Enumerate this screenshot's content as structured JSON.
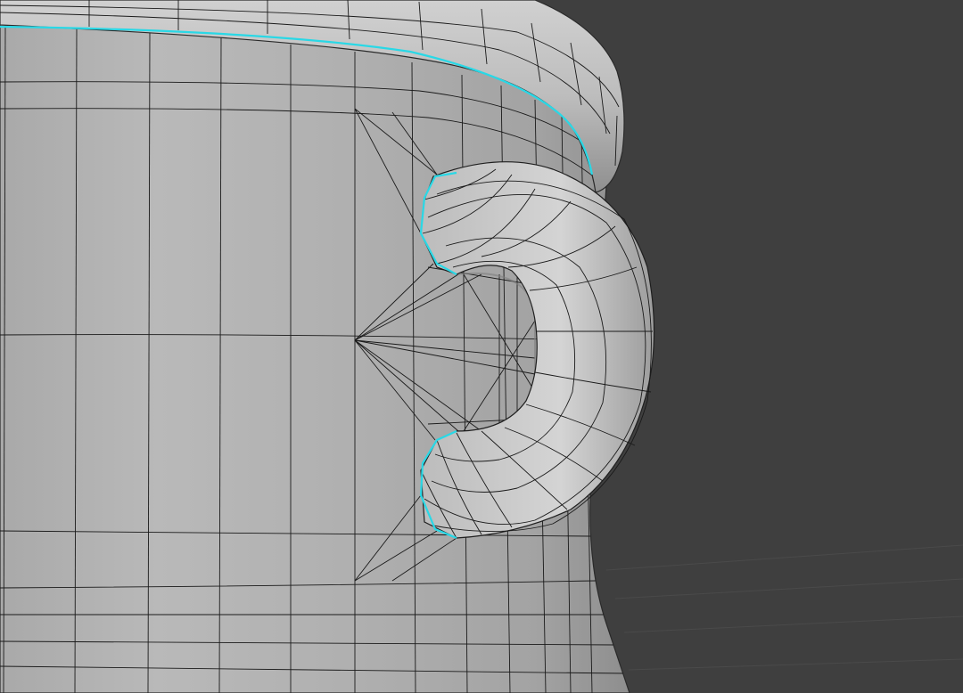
{
  "viewport": {
    "object": "mug",
    "mode": "edit-mode-wireframe-overlay",
    "background_color": "#3f3f3f",
    "mesh_face_color": "#b4b4b4",
    "wire_color": "#1a1a1a",
    "selected_edge_color": "#29d8e6",
    "floor_grid_color": "#4a4a4a"
  }
}
